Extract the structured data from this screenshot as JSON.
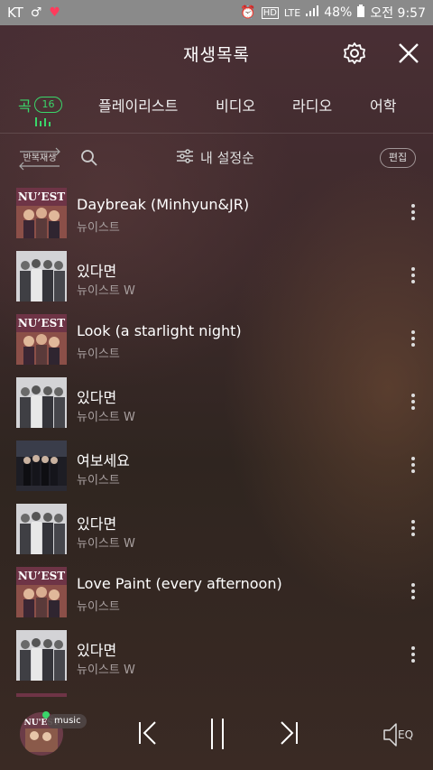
{
  "status_bar": {
    "carrier": "KT",
    "network": "LTE",
    "battery": "48%",
    "time": "오전 9:57"
  },
  "header": {
    "title": "재생목록"
  },
  "tabs": [
    {
      "label": "곡",
      "count": "16",
      "active": true
    },
    {
      "label": "플레이리스트"
    },
    {
      "label": "비디오"
    },
    {
      "label": "라디오"
    },
    {
      "label": "어학"
    }
  ],
  "toolbar": {
    "repeat_label": "반복재생",
    "sort_label": "내 설정순",
    "edit_label": "편집"
  },
  "songs": [
    {
      "title": "Daybreak (Minhyun&JR)",
      "artist": "뉴이스트",
      "art": "nuest"
    },
    {
      "title": "있다면",
      "artist": "뉴이스트 W",
      "art": "w"
    },
    {
      "title": "Look (a starlight night)",
      "artist": "뉴이스트",
      "art": "nuest"
    },
    {
      "title": "있다면",
      "artist": "뉴이스트 W",
      "art": "w"
    },
    {
      "title": "여보세요",
      "artist": "뉴이스트",
      "art": "dark"
    },
    {
      "title": "있다면",
      "artist": "뉴이스트 W",
      "art": "w"
    },
    {
      "title": "Love Paint (every afternoon)",
      "artist": "뉴이스트",
      "art": "nuest"
    },
    {
      "title": "있다면",
      "artist": "뉴이스트 W",
      "art": "w"
    }
  ],
  "player": {
    "badge": "music",
    "eq_label": "EQ"
  },
  "colors": {
    "accent": "#3ad66a"
  }
}
